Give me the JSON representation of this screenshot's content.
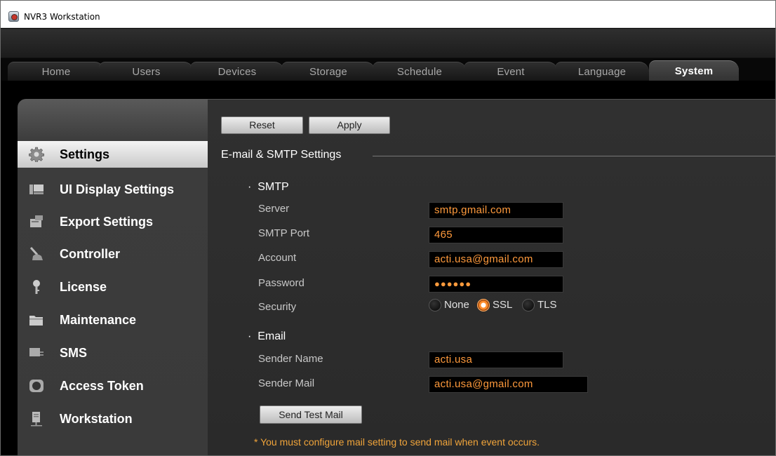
{
  "window": {
    "title": "NVR3 Workstation"
  },
  "tabs": [
    {
      "label": "Home"
    },
    {
      "label": "Users"
    },
    {
      "label": "Devices"
    },
    {
      "label": "Storage"
    },
    {
      "label": "Schedule"
    },
    {
      "label": "Event"
    },
    {
      "label": "Language"
    },
    {
      "label": "System",
      "active": true
    }
  ],
  "sidebar": {
    "items": [
      {
        "label": "Settings",
        "icon": "gear-icon",
        "active": true
      },
      {
        "label": "UI Display Settings",
        "icon": "display-icon"
      },
      {
        "label": "Export Settings",
        "icon": "export-icon"
      },
      {
        "label": "Controller",
        "icon": "joystick-icon"
      },
      {
        "label": "License",
        "icon": "key-icon"
      },
      {
        "label": "Maintenance",
        "icon": "folder-icon"
      },
      {
        "label": "SMS",
        "icon": "sms-icon"
      },
      {
        "label": "Access Token",
        "icon": "token-icon"
      },
      {
        "label": "Workstation",
        "icon": "workstation-icon"
      }
    ]
  },
  "toolbar": {
    "reset_label": "Reset",
    "apply_label": "Apply"
  },
  "section": {
    "title": "E-mail & SMTP Settings"
  },
  "smtp": {
    "title": "SMTP",
    "server_label": "Server",
    "server_value": "smtp.gmail.com",
    "port_label": "SMTP Port",
    "port_value": "465",
    "account_label": "Account",
    "account_value": "acti.usa@gmail.com",
    "password_label": "Password",
    "password_value": "●●●●●●",
    "security_label": "Security",
    "security_options": [
      "None",
      "SSL",
      "TLS"
    ],
    "security_selected": "SSL"
  },
  "email": {
    "title": "Email",
    "sender_name_label": "Sender Name",
    "sender_name_value": "acti.usa",
    "sender_mail_label": "Sender Mail",
    "sender_mail_value": "acti.usa@gmail.com",
    "send_test_label": "Send Test Mail"
  },
  "note": "* You must configure mail setting to send mail when event occurs.",
  "colors": {
    "accent": "#ff9a3c",
    "note": "#f0a43a"
  }
}
